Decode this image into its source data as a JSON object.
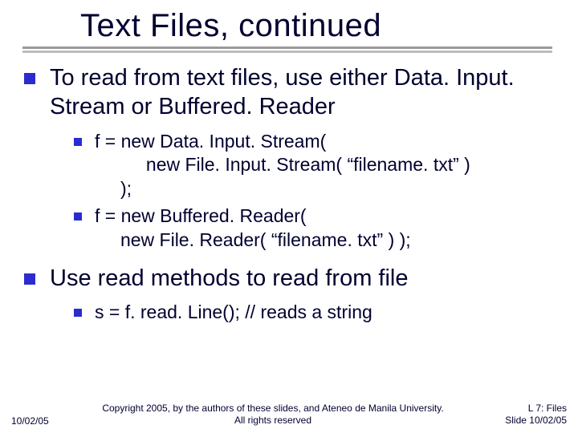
{
  "title": "Text Files, continued",
  "points": {
    "p1": "To read from text files, use either Data. Input. Stream or Buffered. Reader",
    "p1_sub1": "f = new Data. Input. Stream(\n          new File. Input. Stream( “filename. txt” )\n     );",
    "p1_sub2": "f = new Buffered. Reader(\n     new File. Reader( “filename. txt” ) );",
    "p2": "Use read methods to read from file",
    "p2_sub1": "s = f. read. Line(); // reads a string"
  },
  "footer": {
    "left": "10/02/05",
    "center": "Copyright 2005, by the authors of these slides, and Ateneo de Manila University. All rights reserved",
    "right_line1": "L 7: Files",
    "right_line2": "Slide 10/02/05"
  }
}
